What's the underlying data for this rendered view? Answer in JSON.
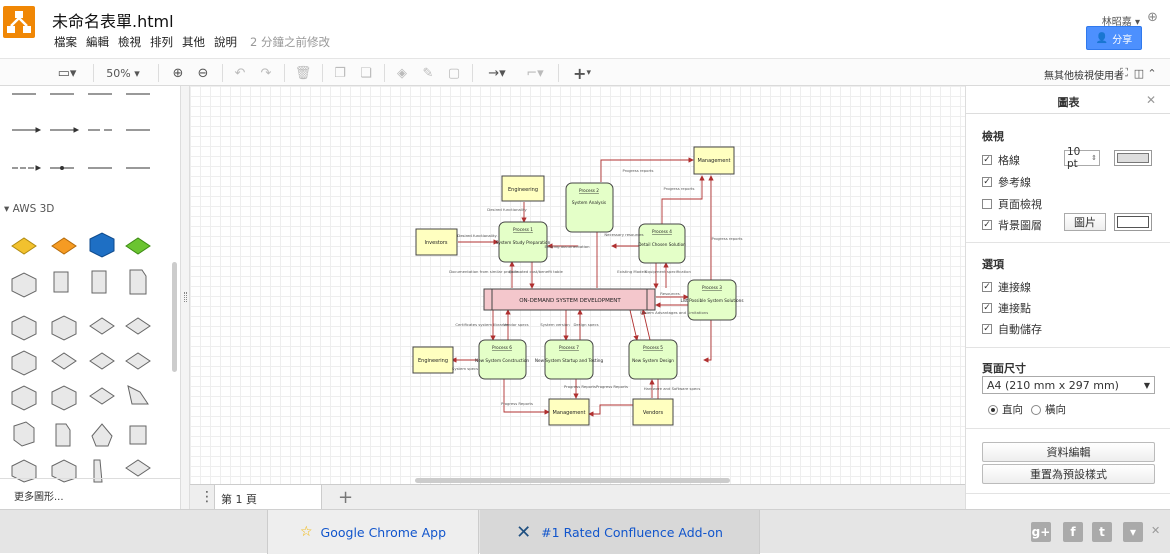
{
  "app": {
    "title": "未命名表單.html",
    "user": "林昭嘉 ▾",
    "share_label": "分享",
    "saved_status": "2 分鐘之前修改"
  },
  "menu": [
    "檔案",
    "編輯",
    "檢視",
    "排列",
    "其他",
    "說明"
  ],
  "toolbar": {
    "zoom": "50%",
    "viewers": "無其他檢視使用者"
  },
  "left_panel": {
    "section": "AWS 3D",
    "more_shapes": "更多圖形..."
  },
  "pages": {
    "current": "第 1 頁"
  },
  "right_panel": {
    "title": "圖表",
    "view_header": "檢視",
    "view_options": [
      {
        "label": "格線",
        "checked": true
      },
      {
        "label": "參考線",
        "checked": true
      },
      {
        "label": "頁面檢視",
        "checked": false
      },
      {
        "label": "背景圖層",
        "checked": true
      }
    ],
    "grid_size": "10 pt",
    "image_button": "圖片",
    "options_header": "選項",
    "options": [
      {
        "label": "連接線",
        "checked": true
      },
      {
        "label": "連接點",
        "checked": true
      },
      {
        "label": "自動儲存",
        "checked": true
      }
    ],
    "page_size_header": "頁面尺寸",
    "page_size": "A4 (210 mm x 297 mm)",
    "orientation_portrait": "直向",
    "orientation_landscape": "橫向",
    "edit_data": "資料編輯",
    "reset_style": "重置為預設樣式"
  },
  "footer": {
    "ad1": "Google Chrome App",
    "ad2": "#1 Rated Confluence Add-on"
  },
  "diagram": {
    "central": "ON-DEMAND SYSTEM DEVELOPMENT",
    "externals": {
      "engineering_top": "Engineering",
      "investors": "Investors",
      "management_top": "Management",
      "engineering_bottom": "Engineering",
      "management_bottom": "Management",
      "vendors": "Vendors"
    },
    "processes": [
      {
        "id": "Process 1",
        "name": "System Study Preparation"
      },
      {
        "id": "Process 2",
        "name": "System Analysis"
      },
      {
        "id": "Process 4",
        "name": "Detail Chosen Solution"
      },
      {
        "id": "Process 3",
        "name": "List Possible System Solutions"
      },
      {
        "id": "Process 6",
        "name": "New System Construction"
      },
      {
        "id": "Process 7",
        "name": "New System Startup and Testing"
      },
      {
        "id": "Process 5",
        "name": "New System Design"
      }
    ],
    "flows": [
      "Desired functionality",
      "Desired functionality",
      "Progress reports",
      "Progress reports",
      "Progress reports",
      "Existing documentation",
      "Necessary resources",
      "Documentation from similar projects",
      "Estimated cost/benefit table",
      "Existing Models",
      "Equipment specification",
      "Resources",
      "System Advantages and Limitations",
      "Certificates system libraries",
      "Vendor specs",
      "System version",
      "Design specs",
      "System specs",
      "Progress Reports",
      "Progress Reports",
      "Progress Reports",
      "Hardware and Software specs"
    ]
  }
}
